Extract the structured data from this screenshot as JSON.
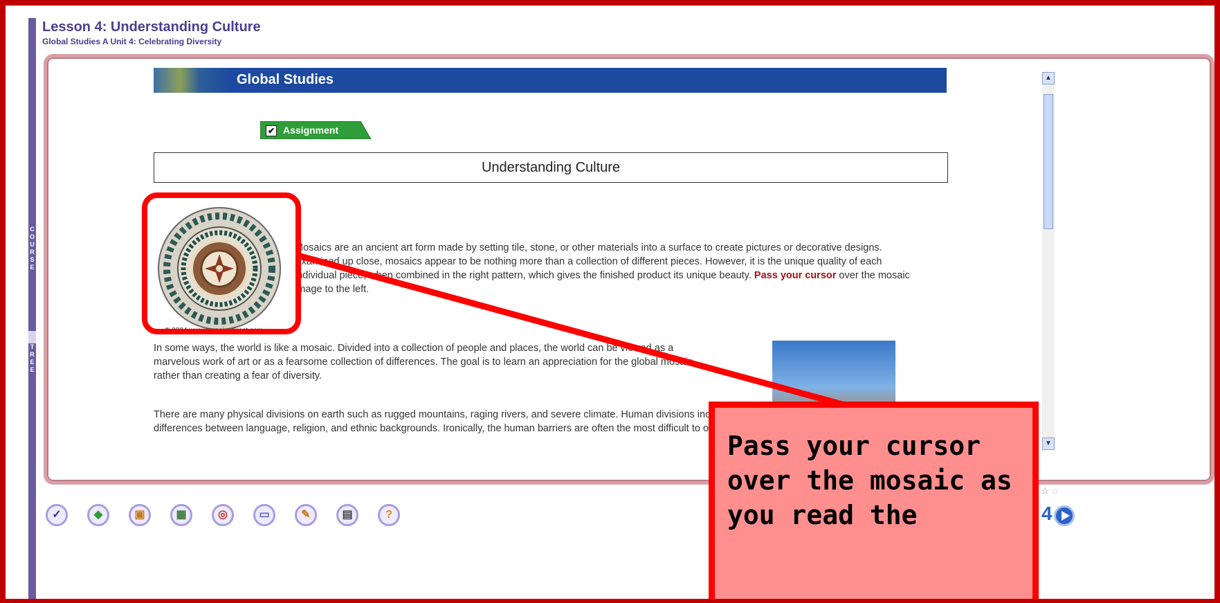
{
  "header": {
    "lesson_title": "Lesson 4: Understanding Culture",
    "lesson_subtitle": "Global Studies A  Unit 4: Celebrating Diversity"
  },
  "side_rail": {
    "label_top": "COURSE",
    "label_bottom": "TREE"
  },
  "content": {
    "banner_title": "Global Studies",
    "assignment_label": "Assignment",
    "section_title": "Understanding Culture",
    "mosaic_credit": "© 2004 www.mosaicsdirect.com",
    "paragraph1_text": "Mosaics are an ancient art form made by setting tile, stone, or other materials into a surface to create pictures or decorative designs. Examined up close, mosaics appear to be nothing more than a collection of different pieces. However, it is the unique quality of each individual piece, when combined in the right pattern, which gives the finished product its unique beauty. ",
    "paragraph1_emphasis": "Pass your cursor",
    "paragraph1_tail": " over the mosaic image to the left.",
    "paragraph2": "In some ways, the world is like a mosaic. Divided into a collection of people and places, the world can be viewed as a marvelous work of art or as a fearsome collection of differences. The goal is to learn an appreciation for the global mosaic rather than creating a fear of diversity.",
    "paragraph3": "There are many physical divisions on earth such as rugged mountains, raging rivers, and severe climate. Human divisions include differences between language, religion, and ethnic backgrounds. Ironically, the human barriers are often the most difficult to overcome."
  },
  "callout": {
    "text": "Pass your cursor over the mosaic as you read the"
  },
  "toolbar": {
    "buttons": [
      "check-icon",
      "bookmark-icon",
      "folder-icon",
      "notes-icon",
      "target-icon",
      "chat-icon",
      "print-icon",
      "printer-icon",
      "help-icon"
    ]
  },
  "navigation": {
    "page_number": "4"
  }
}
